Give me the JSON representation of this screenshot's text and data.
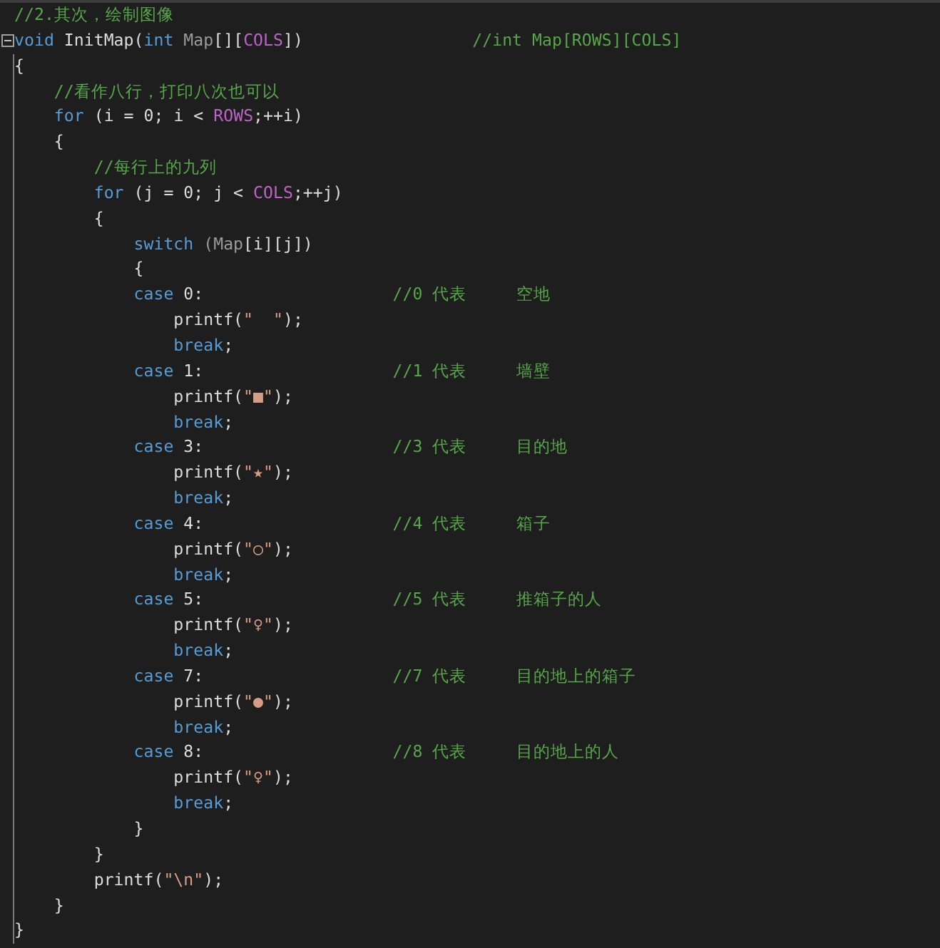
{
  "editor": {
    "lines": [
      {
        "fold": false,
        "tokens": [
          {
            "kind": "comment",
            "text": "//2.其次，绘制图像"
          }
        ]
      },
      {
        "fold": true,
        "tokens": [
          {
            "kind": "keyword",
            "text": "void"
          },
          {
            "kind": "plain",
            "text": " InitMap("
          },
          {
            "kind": "keyword",
            "text": "int"
          },
          {
            "kind": "param",
            "text": " Map"
          },
          {
            "kind": "plain",
            "text": "[]["
          },
          {
            "kind": "macro",
            "text": "COLS"
          },
          {
            "kind": "plain",
            "text": "])                 "
          },
          {
            "kind": "comment",
            "text": "//int Map[ROWS][COLS]"
          }
        ]
      },
      {
        "fold": false,
        "tokens": [
          {
            "kind": "plain",
            "text": "{"
          }
        ]
      },
      {
        "fold": false,
        "tokens": [
          {
            "kind": "comment",
            "text": "    //看作八行，打印八次也可以"
          }
        ]
      },
      {
        "fold": false,
        "tokens": [
          {
            "kind": "keyword",
            "text": "    for"
          },
          {
            "kind": "plain",
            "text": " (i = 0; i < "
          },
          {
            "kind": "macro",
            "text": "ROWS"
          },
          {
            "kind": "plain",
            "text": ";++i)"
          }
        ]
      },
      {
        "fold": false,
        "tokens": [
          {
            "kind": "plain",
            "text": "    {"
          }
        ]
      },
      {
        "fold": false,
        "tokens": [
          {
            "kind": "comment",
            "text": "        //每行上的九列"
          }
        ]
      },
      {
        "fold": false,
        "tokens": [
          {
            "kind": "keyword",
            "text": "        for"
          },
          {
            "kind": "plain",
            "text": " (j = 0; j < "
          },
          {
            "kind": "macro",
            "text": "COLS"
          },
          {
            "kind": "plain",
            "text": ";++j)"
          }
        ]
      },
      {
        "fold": false,
        "tokens": [
          {
            "kind": "plain",
            "text": "        {"
          }
        ]
      },
      {
        "fold": false,
        "tokens": [
          {
            "kind": "keyword",
            "text": "            switch"
          },
          {
            "kind": "param",
            "text": " (Map"
          },
          {
            "kind": "plain",
            "text": "[i][j])"
          }
        ]
      },
      {
        "fold": false,
        "tokens": [
          {
            "kind": "plain",
            "text": "            {"
          }
        ]
      },
      {
        "fold": false,
        "tokens": [
          {
            "kind": "keyword",
            "text": "            case"
          },
          {
            "kind": "plain",
            "text": " 0:                   "
          },
          {
            "kind": "comment",
            "text": "//0 代表     空地"
          }
        ]
      },
      {
        "fold": false,
        "tokens": [
          {
            "kind": "plain",
            "text": "                printf("
          },
          {
            "kind": "string",
            "text": "\"  \""
          },
          {
            "kind": "plain",
            "text": ");"
          }
        ]
      },
      {
        "fold": false,
        "tokens": [
          {
            "kind": "keyword",
            "text": "                break"
          },
          {
            "kind": "plain",
            "text": ";"
          }
        ]
      },
      {
        "fold": false,
        "tokens": [
          {
            "kind": "keyword",
            "text": "            case"
          },
          {
            "kind": "plain",
            "text": " 1:                   "
          },
          {
            "kind": "comment",
            "text": "//1 代表     墙壁"
          }
        ]
      },
      {
        "fold": false,
        "tokens": [
          {
            "kind": "plain",
            "text": "                printf("
          },
          {
            "kind": "string",
            "text": "\"■\""
          },
          {
            "kind": "plain",
            "text": ");"
          }
        ]
      },
      {
        "fold": false,
        "tokens": [
          {
            "kind": "keyword",
            "text": "                break"
          },
          {
            "kind": "plain",
            "text": ";"
          }
        ]
      },
      {
        "fold": false,
        "tokens": [
          {
            "kind": "keyword",
            "text": "            case"
          },
          {
            "kind": "plain",
            "text": " 3:                   "
          },
          {
            "kind": "comment",
            "text": "//3 代表     目的地"
          }
        ]
      },
      {
        "fold": false,
        "tokens": [
          {
            "kind": "plain",
            "text": "                printf("
          },
          {
            "kind": "string",
            "text": "\"★\""
          },
          {
            "kind": "plain",
            "text": ");"
          }
        ]
      },
      {
        "fold": false,
        "tokens": [
          {
            "kind": "keyword",
            "text": "                break"
          },
          {
            "kind": "plain",
            "text": ";"
          }
        ]
      },
      {
        "fold": false,
        "tokens": [
          {
            "kind": "keyword",
            "text": "            case"
          },
          {
            "kind": "plain",
            "text": " 4:                   "
          },
          {
            "kind": "comment",
            "text": "//4 代表     箱子"
          }
        ]
      },
      {
        "fold": false,
        "tokens": [
          {
            "kind": "plain",
            "text": "                printf("
          },
          {
            "kind": "string",
            "text": "\"○\""
          },
          {
            "kind": "plain",
            "text": ");"
          }
        ]
      },
      {
        "fold": false,
        "tokens": [
          {
            "kind": "keyword",
            "text": "                break"
          },
          {
            "kind": "plain",
            "text": ";"
          }
        ]
      },
      {
        "fold": false,
        "tokens": [
          {
            "kind": "keyword",
            "text": "            case"
          },
          {
            "kind": "plain",
            "text": " 5:                   "
          },
          {
            "kind": "comment",
            "text": "//5 代表     推箱子的人"
          }
        ]
      },
      {
        "fold": false,
        "tokens": [
          {
            "kind": "plain",
            "text": "                printf("
          },
          {
            "kind": "string",
            "text": "\"♀\""
          },
          {
            "kind": "plain",
            "text": ");"
          }
        ]
      },
      {
        "fold": false,
        "tokens": [
          {
            "kind": "keyword",
            "text": "                break"
          },
          {
            "kind": "plain",
            "text": ";"
          }
        ]
      },
      {
        "fold": false,
        "tokens": [
          {
            "kind": "keyword",
            "text": "            case"
          },
          {
            "kind": "plain",
            "text": " 7:                   "
          },
          {
            "kind": "comment",
            "text": "//7 代表     目的地上的箱子"
          }
        ]
      },
      {
        "fold": false,
        "tokens": [
          {
            "kind": "plain",
            "text": "                printf("
          },
          {
            "kind": "string",
            "text": "\"●\""
          },
          {
            "kind": "plain",
            "text": ");"
          }
        ]
      },
      {
        "fold": false,
        "tokens": [
          {
            "kind": "keyword",
            "text": "                break"
          },
          {
            "kind": "plain",
            "text": ";"
          }
        ]
      },
      {
        "fold": false,
        "tokens": [
          {
            "kind": "keyword",
            "text": "            case"
          },
          {
            "kind": "plain",
            "text": " 8:                   "
          },
          {
            "kind": "comment",
            "text": "//8 代表     目的地上的人"
          }
        ]
      },
      {
        "fold": false,
        "tokens": [
          {
            "kind": "plain",
            "text": "                printf("
          },
          {
            "kind": "string",
            "text": "\"♀\""
          },
          {
            "kind": "plain",
            "text": ");"
          }
        ]
      },
      {
        "fold": false,
        "tokens": [
          {
            "kind": "keyword",
            "text": "                break"
          },
          {
            "kind": "plain",
            "text": ";"
          }
        ]
      },
      {
        "fold": false,
        "tokens": [
          {
            "kind": "plain",
            "text": "            }"
          }
        ]
      },
      {
        "fold": false,
        "tokens": [
          {
            "kind": "plain",
            "text": "        }"
          }
        ]
      },
      {
        "fold": false,
        "tokens": [
          {
            "kind": "plain",
            "text": "        printf("
          },
          {
            "kind": "string",
            "text": "\"\\n\""
          },
          {
            "kind": "plain",
            "text": ");"
          }
        ]
      },
      {
        "fold": false,
        "tokens": [
          {
            "kind": "plain",
            "text": "    }"
          }
        ]
      },
      {
        "fold": false,
        "tokens": [
          {
            "kind": "plain",
            "text": "}"
          }
        ]
      }
    ]
  }
}
